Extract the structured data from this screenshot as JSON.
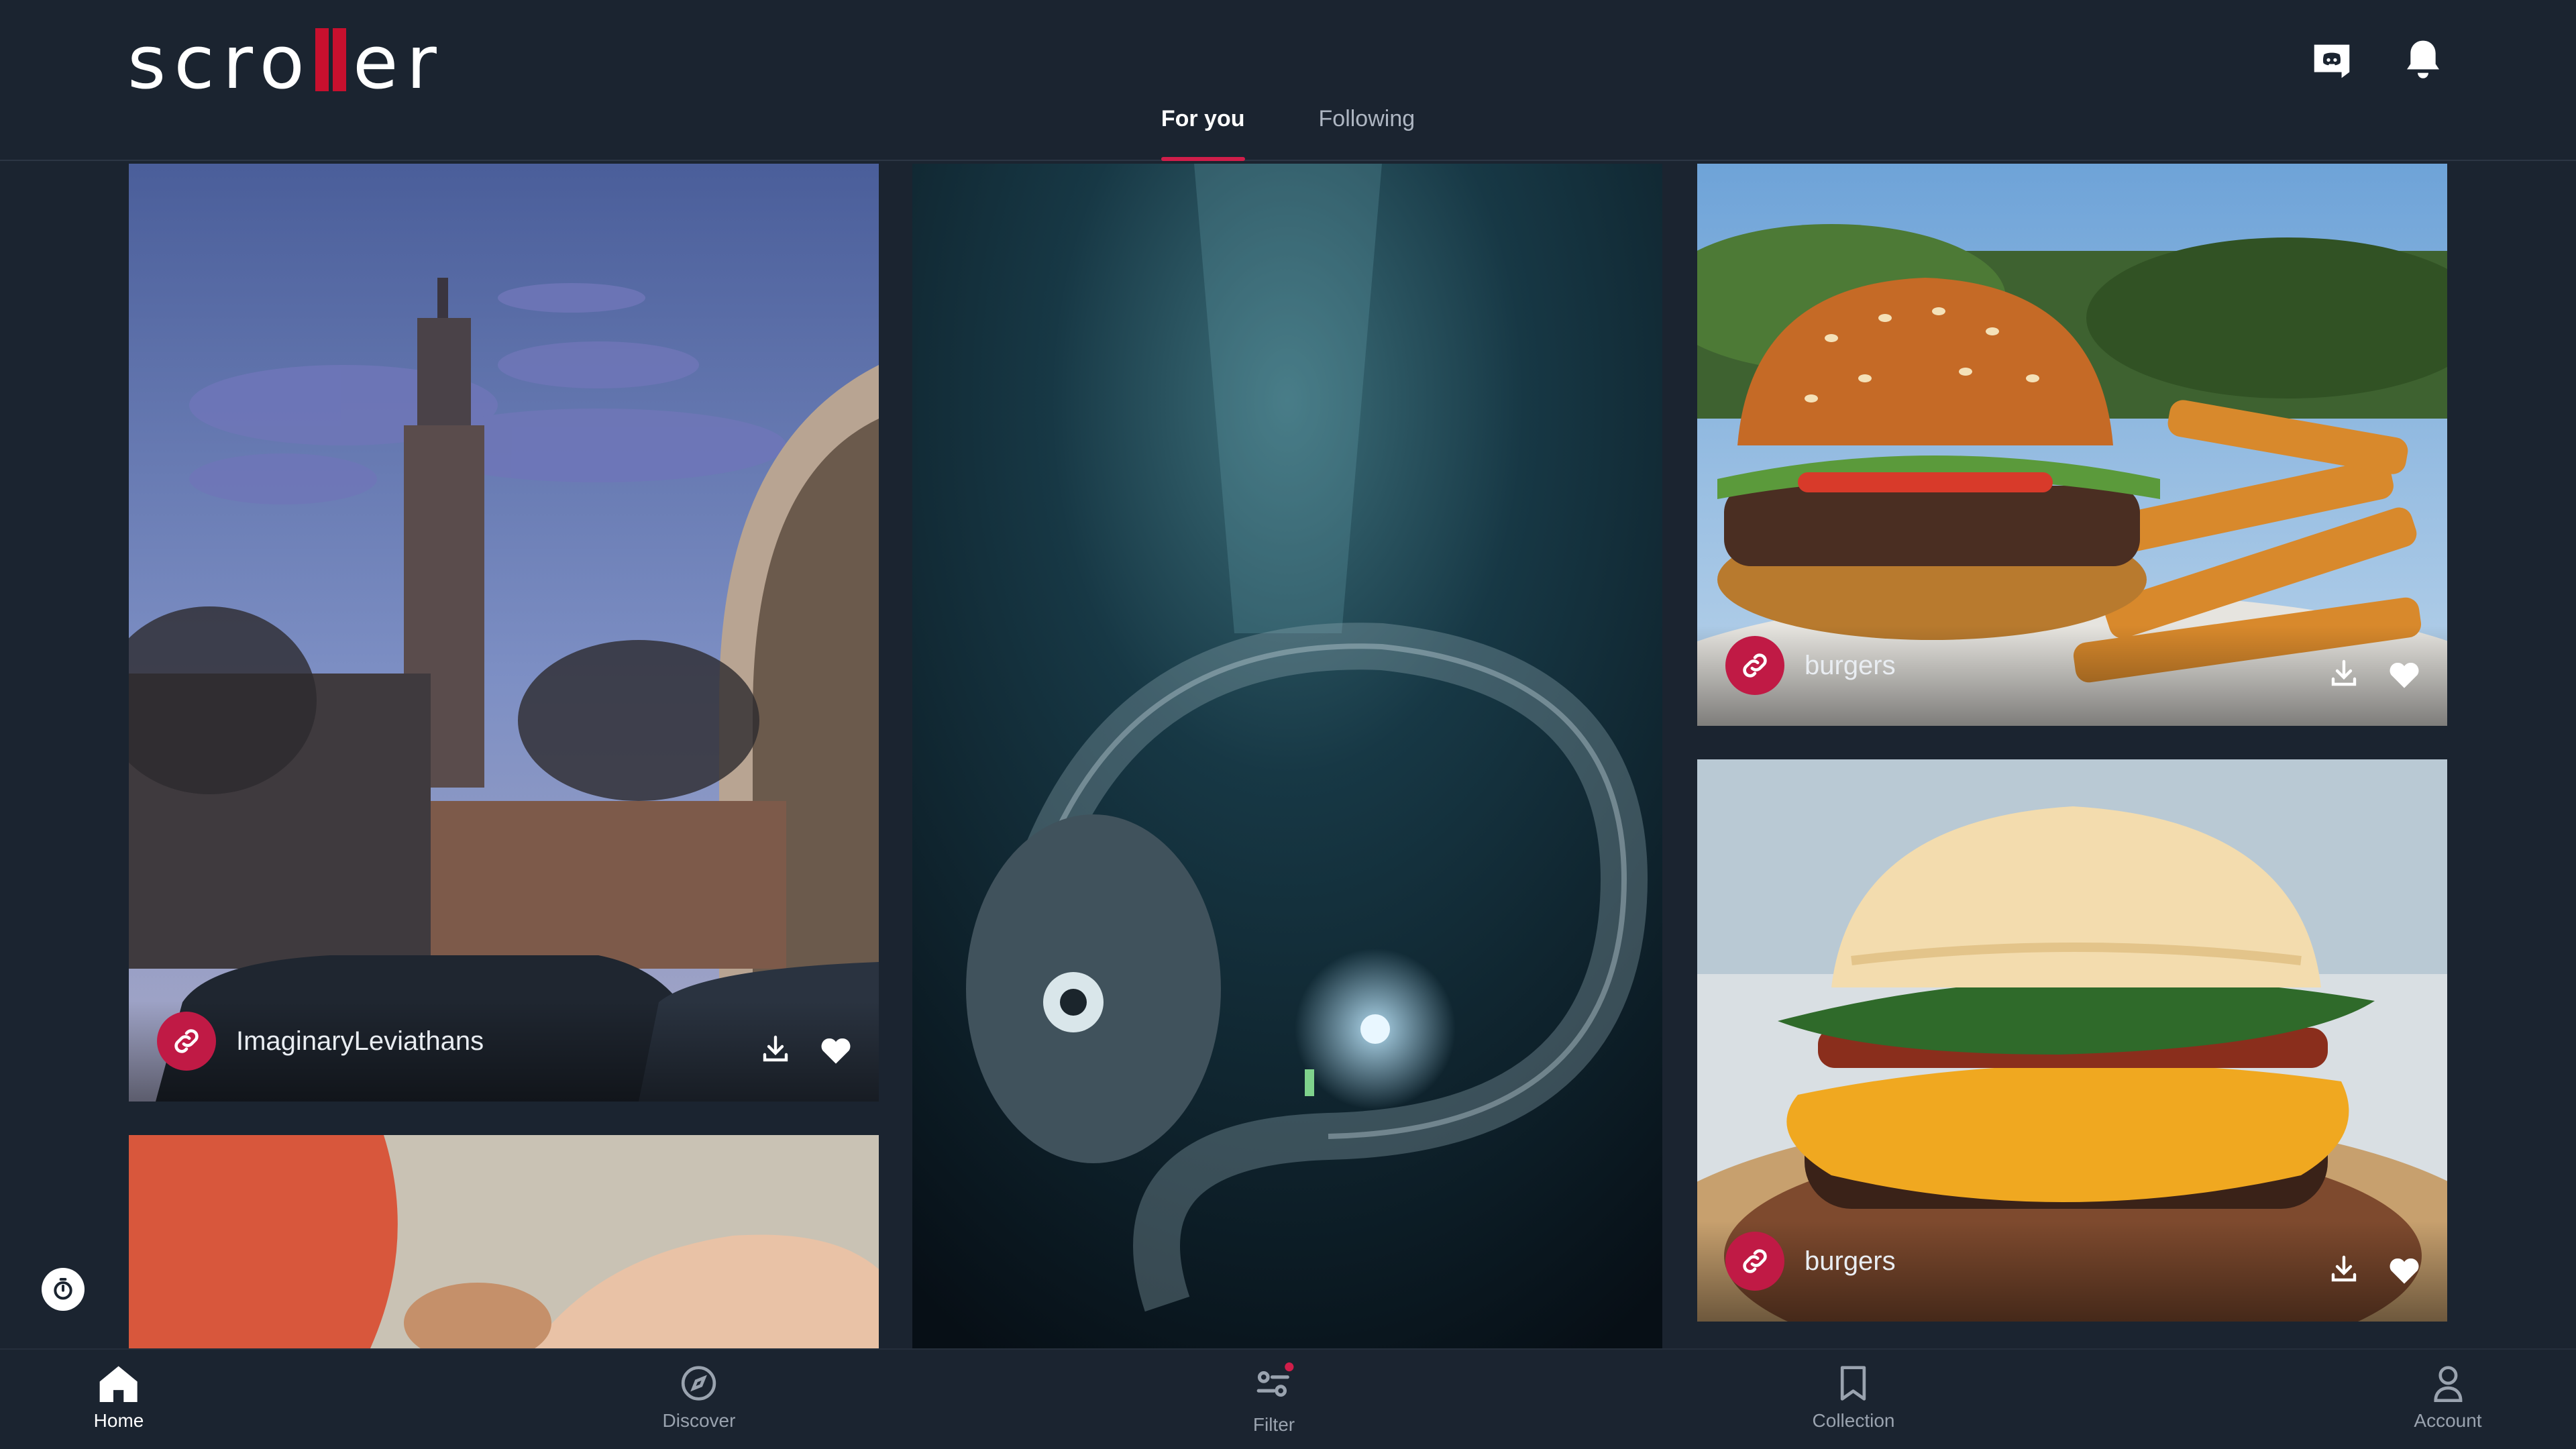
{
  "app": {
    "logo_text_left": "scro",
    "logo_text_right": "er",
    "accent_color": "#d01e4a"
  },
  "header": {
    "icons": [
      "discord-icon",
      "bell-icon"
    ]
  },
  "tabs": [
    {
      "label": "For you",
      "active": true
    },
    {
      "label": "Following",
      "active": false
    }
  ],
  "feed": {
    "cards": [
      {
        "subreddit": "ImaginaryLeviathans",
        "image": "whales-flying-over-tower"
      },
      {
        "subreddit": "",
        "image": "deep-sea-creature-with-diver"
      },
      {
        "subreddit": "burgers",
        "image": "burger-with-fries"
      },
      {
        "subreddit": "burgers",
        "image": "double-cheeseburger"
      },
      {
        "subreddit": "",
        "image": "hands-holding-item"
      }
    ]
  },
  "bottom_nav": [
    {
      "label": "Home",
      "icon": "home-icon",
      "active": true
    },
    {
      "label": "Discover",
      "icon": "compass-icon",
      "active": false
    },
    {
      "label": "Filter",
      "icon": "filter-icon",
      "active": false
    },
    {
      "label": "Collection",
      "icon": "bookmark-icon",
      "active": false
    },
    {
      "label": "Account",
      "icon": "user-icon",
      "active": false
    }
  ]
}
